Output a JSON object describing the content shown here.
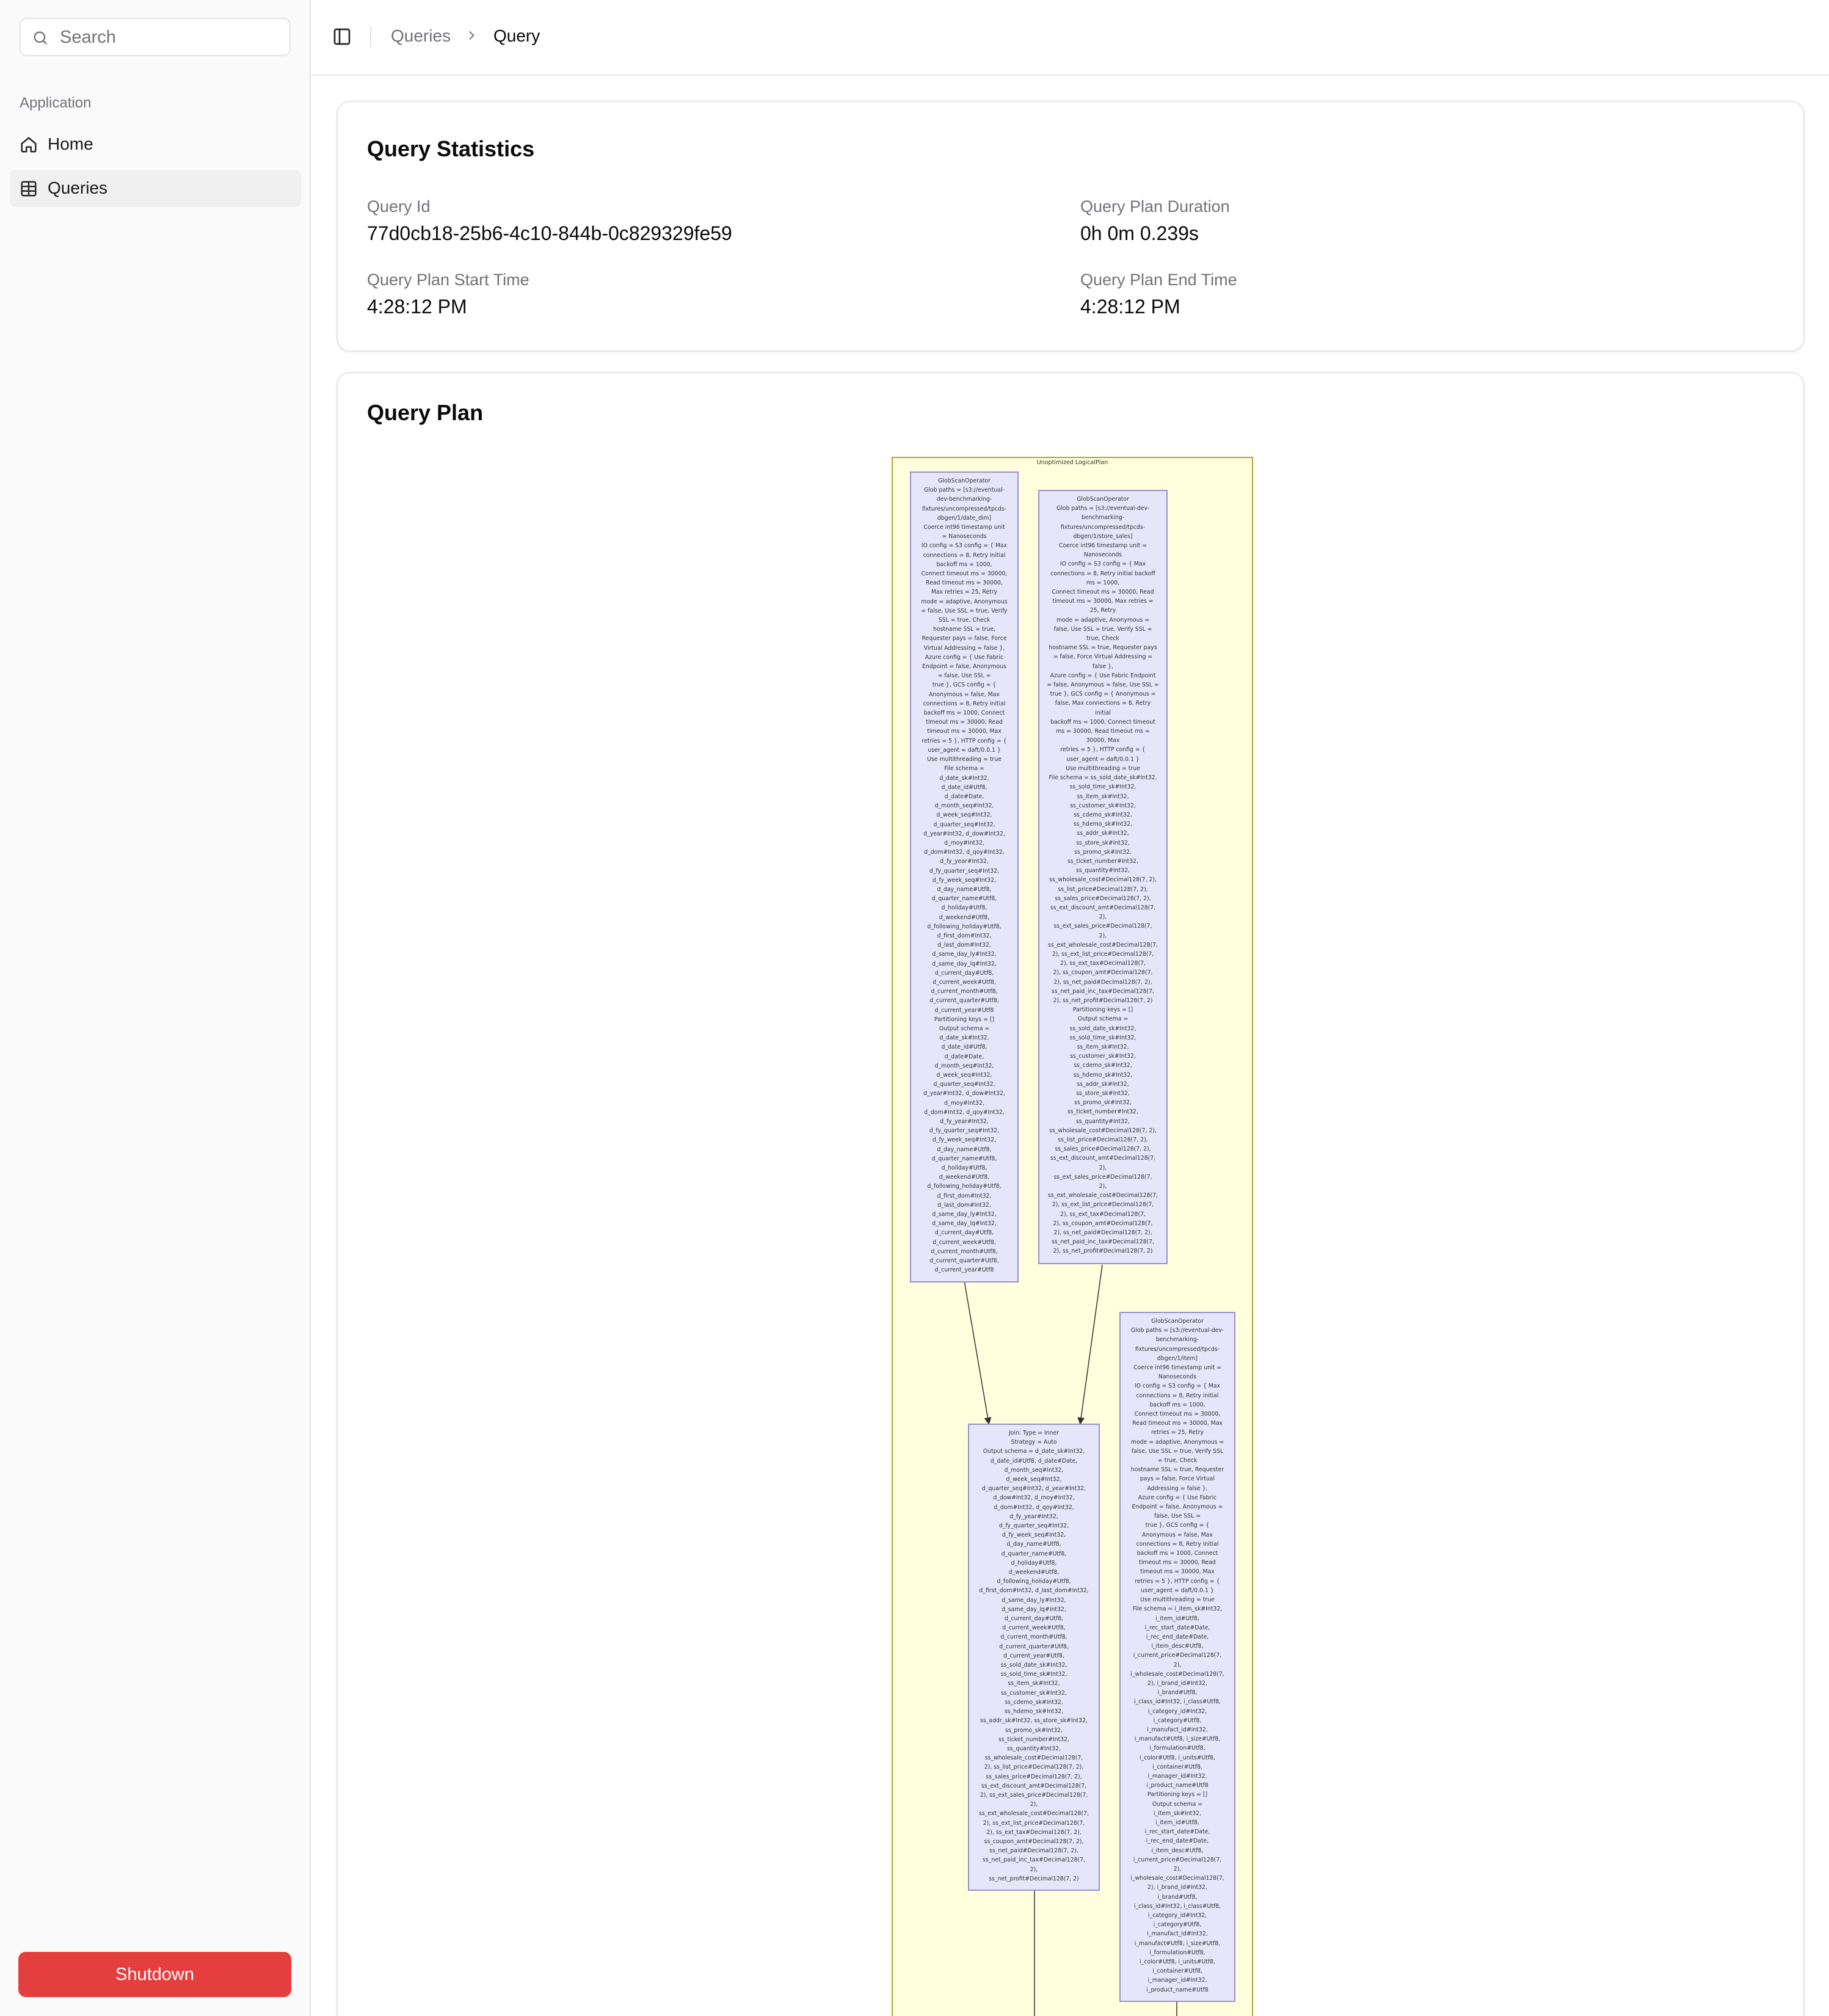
{
  "sidebar": {
    "search_placeholder": "Search",
    "group_label": "Application",
    "items": [
      {
        "label": "Home",
        "icon": "home-icon"
      },
      {
        "label": "Queries",
        "icon": "table-icon"
      }
    ],
    "shutdown_label": "Shutdown"
  },
  "header": {
    "breadcrumb": [
      "Queries",
      "Query"
    ]
  },
  "stats": {
    "title": "Query Statistics",
    "fields": [
      {
        "label": "Query Id",
        "value": "77d0cb18-25b6-4c10-844b-0c829329fe59"
      },
      {
        "label": "Query Plan Duration",
        "value": "0h 0m 0.239s"
      },
      {
        "label": "Query Plan Start Time",
        "value": "4:28:12 PM"
      },
      {
        "label": "Query Plan End Time",
        "value": "4:28:12 PM"
      }
    ]
  },
  "plan": {
    "title": "Query Plan",
    "cluster_label": "Unoptimized LogicalPlan",
    "nodes": {
      "scan_date_dim": "GlobScanOperator\nGlob paths = [s3://eventual-\ndev-benchmarking-\nfixtures/uncompressed/tpcds-\ndbgen/1/date_dim]\nCoerce int96 timestamp unit\n= Nanoseconds\nIO config = S3 config = { Max\nconnections = 8, Retry initial\nbackoff ms = 1000,\nConnect timeout ms = 30000,\nRead timeout ms = 30000,\nMax retries = 25, Retry\nmode = adaptive, Anonymous\n= false, Use SSL = true, Verify\nSSL = true, Check\nhostname SSL = true,\nRequester pays = false, Force\nVirtual Addressing = false },\nAzure config = { Use Fabric\nEndpoint = false, Anonymous\n= false, Use SSL =\ntrue }, GCS config = {\nAnonymous = false, Max\nconnections = 8, Retry initial\nbackoff ms = 1000, Connect\ntimeout ms = 30000, Read\ntimeout ms = 30000, Max\nretries = 5 }, HTTP config = {\nuser_agent = daft/0.0.1 }\nUse multithreading = true\nFile schema =\nd_date_sk#Int32,\nd_date_id#Utf8,\nd_date#Date,\nd_month_seq#Int32,\nd_week_seq#Int32,\nd_quarter_seq#Int32,\nd_year#Int32, d_dow#Int32,\nd_moy#Int32,\nd_dom#Int32, d_qoy#Int32,\nd_fy_year#Int32,\nd_fy_quarter_seq#Int32,\nd_fy_week_seq#Int32,\nd_day_name#Utf8,\nd_quarter_name#Utf8,\nd_holiday#Utf8,\nd_weekend#Utf8,\nd_following_holiday#Utf8,\nd_first_dom#Int32,\nd_last_dom#Int32,\nd_same_day_ly#Int32,\nd_same_day_lq#Int32,\nd_current_day#Utf8,\nd_current_week#Utf8,\nd_current_month#Utf8,\nd_current_quarter#Utf8,\nd_current_year#Utf8\nPartitioning keys = []\nOutput schema =\nd_date_sk#Int32,\nd_date_id#Utf8,\nd_date#Date,\nd_month_seq#Int32,\nd_week_seq#Int32,\nd_quarter_seq#Int32,\nd_year#Int32, d_dow#Int32,\nd_moy#Int32,\nd_dom#Int32, d_qoy#Int32,\nd_fy_year#Int32,\nd_fy_quarter_seq#Int32,\nd_fy_week_seq#Int32,\nd_day_name#Utf8,\nd_quarter_name#Utf8,\nd_holiday#Utf8,\nd_weekend#Utf8,\nd_following_holiday#Utf8,\nd_first_dom#Int32,\nd_last_dom#Int32,\nd_same_day_ly#Int32,\nd_same_day_lq#Int32,\nd_current_day#Utf8,\nd_current_week#Utf8,\nd_current_month#Utf8,\nd_current_quarter#Utf8,\nd_current_year#Utf8",
      "scan_store_sales": "GlobScanOperator\nGlob paths = [s3://eventual-dev-\nbenchmarking-\nfixtures/uncompressed/tpcds-\ndbgen/1/store_sales]\nCoerce int96 timestamp unit =\nNanoseconds\nIO config = S3 config = { Max\nconnections = 8, Retry initial backoff\nms = 1000,\nConnect timeout ms = 30000, Read\ntimeout ms = 30000, Max retries =\n25, Retry\nmode = adaptive, Anonymous =\nfalse, Use SSL = true, Verify SSL =\ntrue, Check\nhostname SSL = true, Requester pays\n= false, Force Virtual Addressing =\nfalse },\nAzure config = { Use Fabric Endpoint\n= false, Anonymous = false, Use SSL =\ntrue }, GCS config = { Anonymous =\nfalse, Max connections = 8, Retry\ninitial\nbackoff ms = 1000, Connect timeout\nms = 30000, Read timeout ms =\n30000, Max\nretries = 5 }, HTTP config = {\nuser_agent = daft/0.0.1 }\nUse multithreading = true\nFile schema = ss_sold_date_sk#Int32,\nss_sold_time_sk#Int32,\nss_item_sk#Int32,\nss_customer_sk#Int32,\nss_cdemo_sk#Int32,\nss_hdemo_sk#Int32,\nss_addr_sk#Int32,\nss_store_sk#Int32,\nss_promo_sk#Int32,\nss_ticket_number#Int32,\nss_quantity#Int32,\nss_wholesale_cost#Decimal128(7, 2),\nss_list_price#Decimal128(7, 2),\nss_sales_price#Decimal128(7, 2),\nss_ext_discount_amt#Decimal128(7,\n2),\nss_ext_sales_price#Decimal128(7,\n2),\nss_ext_wholesale_cost#Decimal128(7,\n2), ss_ext_list_price#Decimal128(7,\n2), ss_ext_tax#Decimal128(7,\n2), ss_coupon_amt#Decimal128(7,\n2), ss_net_paid#Decimal128(7, 2),\nss_net_paid_inc_tax#Decimal128(7,\n2), ss_net_profit#Decimal128(7, 2)\nPartitioning keys = []\nOutput schema =\nss_sold_date_sk#Int32,\nss_sold_time_sk#Int32,\nss_item_sk#Int32,\nss_customer_sk#Int32,\nss_cdemo_sk#Int32,\nss_hdemo_sk#Int32,\nss_addr_sk#Int32,\nss_store_sk#Int32,\nss_promo_sk#Int32,\nss_ticket_number#Int32,\nss_quantity#Int32,\nss_wholesale_cost#Decimal128(7, 2),\nss_list_price#Decimal128(7, 2),\nss_sales_price#Decimal128(7, 2),\nss_ext_discount_amt#Decimal128(7,\n2),\nss_ext_sales_price#Decimal128(7,\n2),\nss_ext_wholesale_cost#Decimal128(7,\n2), ss_ext_list_price#Decimal128(7,\n2), ss_ext_tax#Decimal128(7,\n2), ss_coupon_amt#Decimal128(7,\n2), ss_net_paid#Decimal128(7, 2),\nss_net_paid_inc_tax#Decimal128(7,\n2), ss_net_profit#Decimal128(7, 2)",
      "join": "Join: Type = Inner\nStrategy = Auto\nOutput schema = d_date_sk#Int32,\nd_date_id#Utf8, d_date#Date,\nd_month_seq#Int32,\nd_week_seq#Int32,\nd_quarter_seq#Int32, d_year#Int32,\nd_dow#Int32, d_moy#Int32,\nd_dom#Int32, d_qoy#Int32,\nd_fy_year#Int32,\nd_fy_quarter_seq#Int32,\nd_fy_week_seq#Int32,\nd_day_name#Utf8,\nd_quarter_name#Utf8,\nd_holiday#Utf8,\nd_weekend#Utf8,\nd_following_holiday#Utf8,\nd_first_dom#Int32, d_last_dom#Int32,\nd_same_day_ly#Int32,\nd_same_day_lq#Int32,\nd_current_day#Utf8,\nd_current_week#Utf8,\nd_current_month#Utf8,\nd_current_quarter#Utf8,\nd_current_year#Utf8,\nss_sold_date_sk#Int32,\nss_sold_time_sk#Int32,\nss_item_sk#Int32,\nss_customer_sk#Int32,\nss_cdemo_sk#Int32,\nss_hdemo_sk#Int32,\nss_addr_sk#Int32, ss_store_sk#Int32,\nss_promo_sk#Int32,\nss_ticket_number#Int32,\nss_quantity#Int32,\nss_wholesale_cost#Decimal128(7,\n2), ss_list_price#Decimal128(7, 2),\nss_sales_price#Decimal128(7, 2),\nss_ext_discount_amt#Decimal128(7,\n2), ss_ext_sales_price#Decimal128(7,\n2),\nss_ext_wholesale_cost#Decimal128(7,\n2), ss_ext_list_price#Decimal128(7,\n2), ss_ext_tax#Decimal128(7, 2),\nss_coupon_amt#Decimal128(7, 2),\nss_net_paid#Decimal128(7, 2),\nss_net_paid_inc_tax#Decimal128(7,\n2),\nss_net_profit#Decimal128(7, 2)",
      "scan_item": "GlobScanOperator\nGlob paths = [s3://eventual-dev-\nbenchmarking-\nfixtures/uncompressed/tpcds-\ndbgen/1/item]\nCoerce int96 timestamp unit =\nNanoseconds\nIO config = S3 config = { Max\nconnections = 8, Retry initial\nbackoff ms = 1000,\nConnect timeout ms = 30000,\nRead timeout ms = 30000, Max\nretries = 25, Retry\nmode = adaptive, Anonymous =\nfalse, Use SSL = true, Verify SSL\n= true, Check\nhostname SSL = true, Requester\npays = false, Force Virtual\nAddressing = false },\nAzure config = { Use Fabric\nEndpoint = false, Anonymous =\nfalse, Use SSL =\ntrue }, GCS config = {\nAnonymous = false, Max\nconnections = 8, Retry initial\nbackoff ms = 1000, Connect\ntimeout ms = 30000, Read\ntimeout ms = 30000, Max\nretries = 5 }, HTTP config = {\nuser_agent = daft/0.0.1 }\nUse multithreading = true\nFile schema = i_item_sk#Int32,\ni_item_id#Utf8,\ni_rec_start_date#Date,\ni_rec_end_date#Date,\ni_item_desc#Utf8,\ni_current_price#Decimal128(7,\n2),\ni_wholesale_cost#Decimal128(7,\n2), i_brand_id#Int32,\ni_brand#Utf8,\ni_class_id#Int32, i_class#Utf8,\ni_category_id#Int32,\ni_category#Utf8,\ni_manufact_id#Int32,\ni_manufact#Utf8, i_size#Utf8,\ni_formulation#Utf8,\ni_color#Utf8, i_units#Utf8,\ni_container#Utf8,\ni_manager_id#Int32,\ni_product_name#Utf8\nPartitioning keys = []\nOutput schema =\ni_item_sk#Int32,\ni_item_id#Utf8,\ni_rec_start_date#Date,\ni_rec_end_date#Date,\ni_item_desc#Utf8,\ni_current_price#Decimal128(7,\n2),\ni_wholesale_cost#Decimal128(7,\n2), i_brand_id#Int32,\ni_brand#Utf8,\ni_class_id#Int32, i_class#Utf8,\ni_category_id#Int32,\ni_category#Utf8,\ni_manufact_id#Int32,\ni_manufact#Utf8, i_size#Utf8,\ni_formulation#Utf8,\ni_color#Utf8, i_units#Utf8,\ni_container#Utf8,\ni_manager_id#Int32,\ni_product_name#Utf8"
    }
  }
}
